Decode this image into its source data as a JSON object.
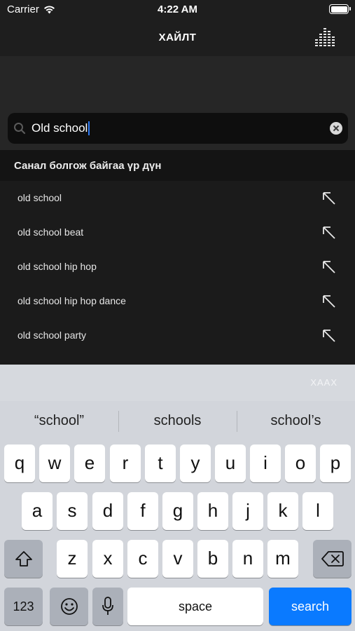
{
  "status_bar": {
    "carrier": "Carrier",
    "time": "4:22 AM"
  },
  "nav": {
    "title": "ХАЙЛТ",
    "right_icon": "equalizer-icon"
  },
  "search": {
    "value": "Old school",
    "icon": "search-icon",
    "clear_icon": "clear-icon"
  },
  "suggestions": {
    "header": "Санал болгож байгаа үр дүн",
    "items": [
      {
        "label": "old school"
      },
      {
        "label": "old school beat"
      },
      {
        "label": "old school hip hop"
      },
      {
        "label": "old school hip hop dance"
      },
      {
        "label": "old school party"
      }
    ],
    "action_icon": "arrow-up-left-icon"
  },
  "keyboard": {
    "dismiss_label": "ХААХ",
    "predictions": [
      "“school”",
      "schools",
      "school’s"
    ],
    "row1": [
      "q",
      "w",
      "e",
      "r",
      "t",
      "y",
      "u",
      "i",
      "o",
      "p"
    ],
    "row2": [
      "a",
      "s",
      "d",
      "f",
      "g",
      "h",
      "j",
      "k",
      "l"
    ],
    "row3": [
      "z",
      "x",
      "c",
      "v",
      "b",
      "n",
      "m"
    ],
    "numbers_label": "123",
    "space_label": "space",
    "search_label": "search",
    "accent_color": "#0a7aff"
  }
}
